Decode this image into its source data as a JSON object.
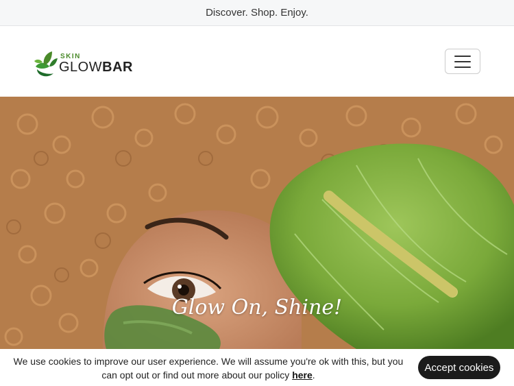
{
  "announcement": {
    "text": "Discover. Shop. Enjoy."
  },
  "logo": {
    "small_text": "SKIN",
    "text_light": "GLOW",
    "text_bold": "BAR"
  },
  "header": {
    "menu_icon": "hamburger-menu-icon"
  },
  "hero": {
    "title": "Glow On, Shine!"
  },
  "cookie_banner": {
    "message": "We use cookies to improve our user experience. We will assume you're ok with this, but you can opt out or find out more about our policy",
    "link_text": "here",
    "accept_label": "Accept cookies"
  },
  "colors": {
    "brand_green": "#4a8a2a",
    "dark": "#1b1b1b"
  }
}
